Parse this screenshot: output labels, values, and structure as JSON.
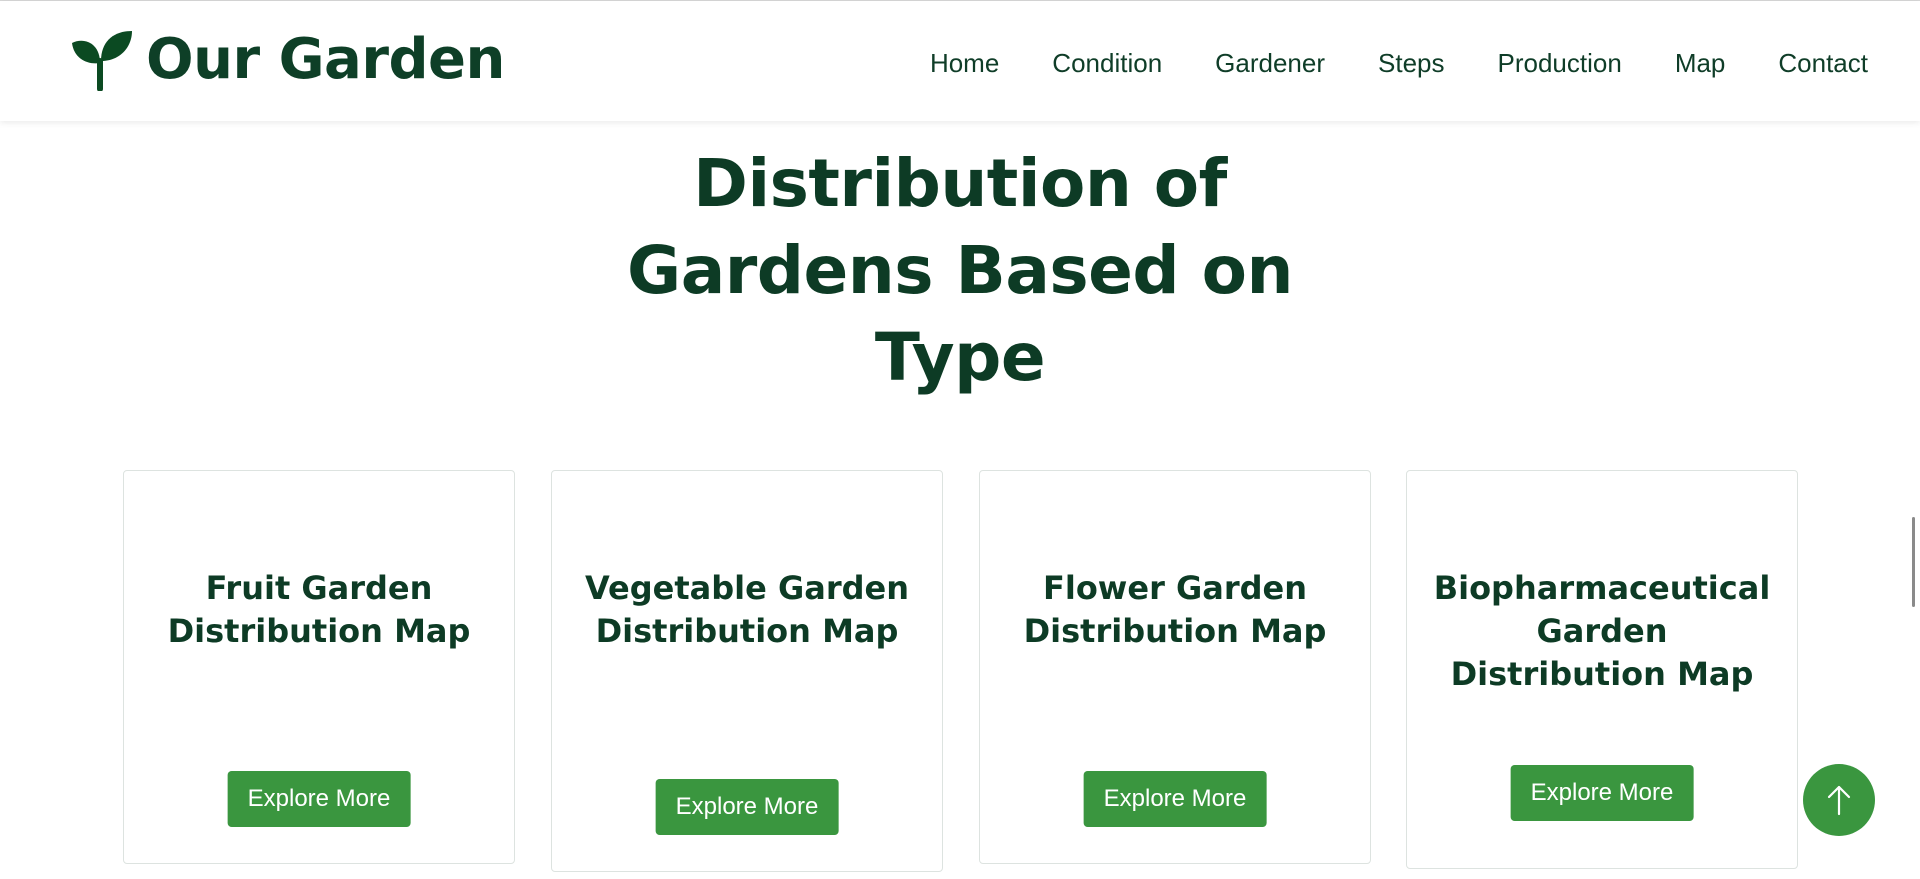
{
  "brand": {
    "name": "Our Garden",
    "icon": "sprout-icon"
  },
  "nav": {
    "items": [
      "Home",
      "Condition",
      "Gardener",
      "Steps",
      "Production",
      "Map",
      "Contact"
    ]
  },
  "section": {
    "title_lines": [
      "Distribution of",
      "Gardens Based on",
      "Type"
    ]
  },
  "cards": [
    {
      "title": "Fruit Garden Distribution Map",
      "button": "Explore More"
    },
    {
      "title": "Vegetable Garden Distribution Map",
      "button": "Explore More"
    },
    {
      "title": "Flower Garden Distribution Map",
      "button": "Explore More"
    },
    {
      "title": "Biopharmaceutical Garden Distribution Map",
      "button": "Explore More"
    }
  ],
  "scroll_top": {
    "icon": "arrow-up-icon"
  },
  "colors": {
    "brand_dark_green": "#0d3b25",
    "accent_green": "#3a963f",
    "card_border": "#dde3e0"
  }
}
